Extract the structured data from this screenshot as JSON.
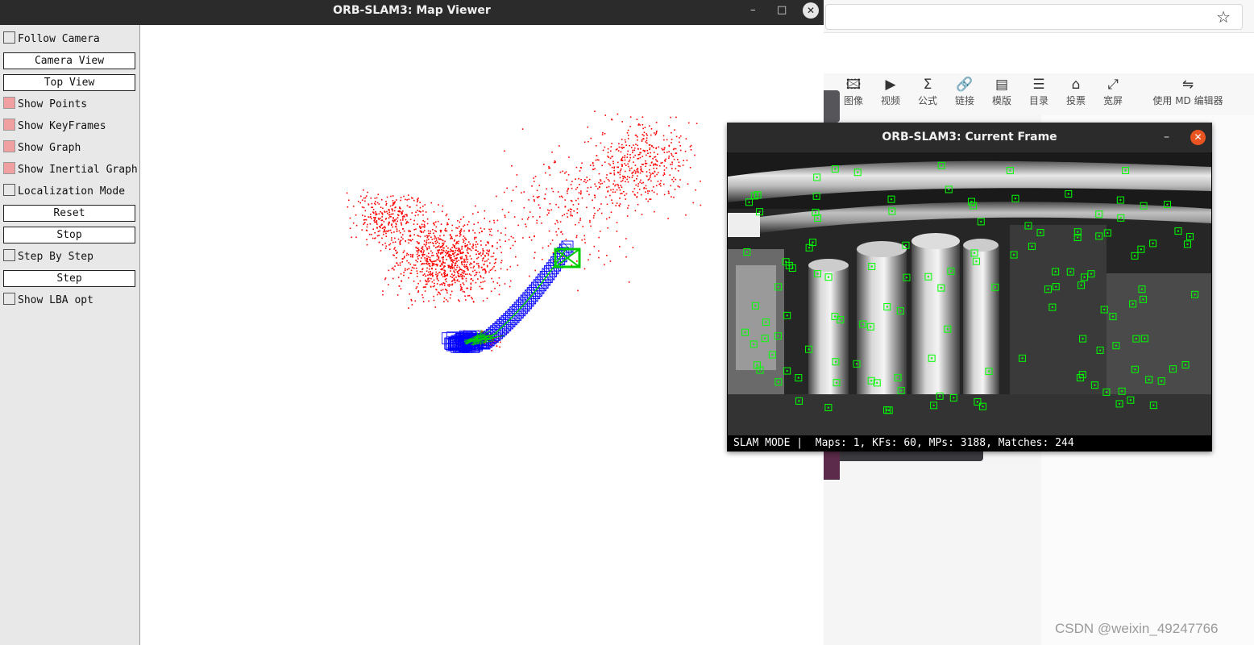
{
  "map_viewer": {
    "title": "ORB-SLAM3: Map Viewer",
    "window_controls": {
      "minimize": "–",
      "maximize": "□",
      "close": "✕"
    },
    "sidebar": {
      "follow_camera": {
        "label": "Follow Camera",
        "checked": false
      },
      "camera_view": "Camera View",
      "top_view": "Top View",
      "show_points": {
        "label": "Show Points",
        "checked": true
      },
      "show_keyframes": {
        "label": "Show KeyFrames",
        "checked": true
      },
      "show_graph": {
        "label": "Show Graph",
        "checked": true
      },
      "show_inertial_graph": {
        "label": "Show Inertial Graph",
        "checked": true
      },
      "localization_mode": {
        "label": "Localization Mode",
        "checked": false
      },
      "reset": "Reset",
      "stop": "Stop",
      "step_by_step": {
        "label": "Step By Step",
        "checked": false
      },
      "step": "Step",
      "show_lba_opt": {
        "label": "Show LBA opt",
        "checked": false
      }
    },
    "colors": {
      "map_points": "#ff0000",
      "keyframes": "#0000ff",
      "graph": "#00cc00",
      "current_camera": "#00cc00"
    }
  },
  "current_frame": {
    "title": "ORB-SLAM3: Current Frame",
    "window_controls": {
      "minimize": "–",
      "close": "✕"
    },
    "status": "SLAM MODE |  Maps: 1, KFs: 60, MPs: 3188, Matches: 244",
    "feature_color": "#00ff00"
  },
  "background_app": {
    "toolbar": [
      {
        "icon": "image-icon",
        "label": "图像"
      },
      {
        "icon": "video-icon",
        "label": "视频"
      },
      {
        "icon": "formula-icon",
        "label": "公式"
      },
      {
        "icon": "link-icon",
        "label": "链接"
      },
      {
        "icon": "template-icon",
        "label": "模版"
      },
      {
        "icon": "list-icon",
        "label": "目录"
      },
      {
        "icon": "vote-icon",
        "label": "投票"
      },
      {
        "icon": "widescreen-icon",
        "label": "宽屏"
      },
      {
        "icon": "switch-icon",
        "label": "使用 MD 编辑器"
      }
    ],
    "bookmark_icon": "☆",
    "watermark": "CSDN @weixin_49247766"
  }
}
